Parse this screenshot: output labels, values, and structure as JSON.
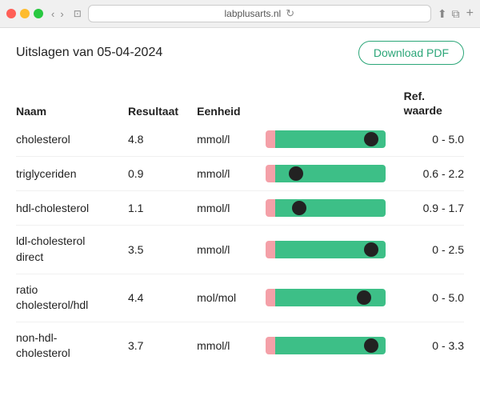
{
  "browser": {
    "url": "labplusarts.nl",
    "reload_icon": "↻",
    "share_icon": "⬆",
    "add_tab_icon": "+",
    "nav_back": "‹",
    "nav_forward": "›",
    "tab_icon": "⊡"
  },
  "header": {
    "title": "Uitslagen van 05-04-2024",
    "download_label": "Download PDF"
  },
  "table": {
    "columns": {
      "naam": "Naam",
      "resultaat": "Resultaat",
      "eenheid": "Eenheid",
      "ref_line1": "Ref.",
      "ref_line2": "waarde"
    },
    "rows": [
      {
        "naam": "cholesterol",
        "naam_line2": "",
        "resultaat": "4.8",
        "eenheid": "mmol/l",
        "ref": "0 - 5.0",
        "pink_pct": 8,
        "dot_pct": 88
      },
      {
        "naam": "triglyceriden",
        "naam_line2": "",
        "resultaat": "0.9",
        "eenheid": "mmol/l",
        "ref": "0.6 - 2.2",
        "pink_pct": 8,
        "dot_pct": 25
      },
      {
        "naam": "hdl-cholesterol",
        "naam_line2": "",
        "resultaat": "1.1",
        "eenheid": "mmol/l",
        "ref": "0.9 - 1.7",
        "pink_pct": 8,
        "dot_pct": 28
      },
      {
        "naam": "ldl-cholesterol",
        "naam_line2": "direct",
        "resultaat": "3.5",
        "eenheid": "mmol/l",
        "ref": "0 - 2.5",
        "pink_pct": 8,
        "dot_pct": 88
      },
      {
        "naam": "ratio",
        "naam_line2": "cholesterol/hdl",
        "resultaat": "4.4",
        "eenheid": "mol/mol",
        "ref": "0 - 5.0",
        "pink_pct": 8,
        "dot_pct": 82
      },
      {
        "naam": "non-hdl-",
        "naam_line2": "cholesterol",
        "resultaat": "3.7",
        "eenheid": "mmol/l",
        "ref": "0 - 3.3",
        "pink_pct": 8,
        "dot_pct": 88
      }
    ]
  }
}
